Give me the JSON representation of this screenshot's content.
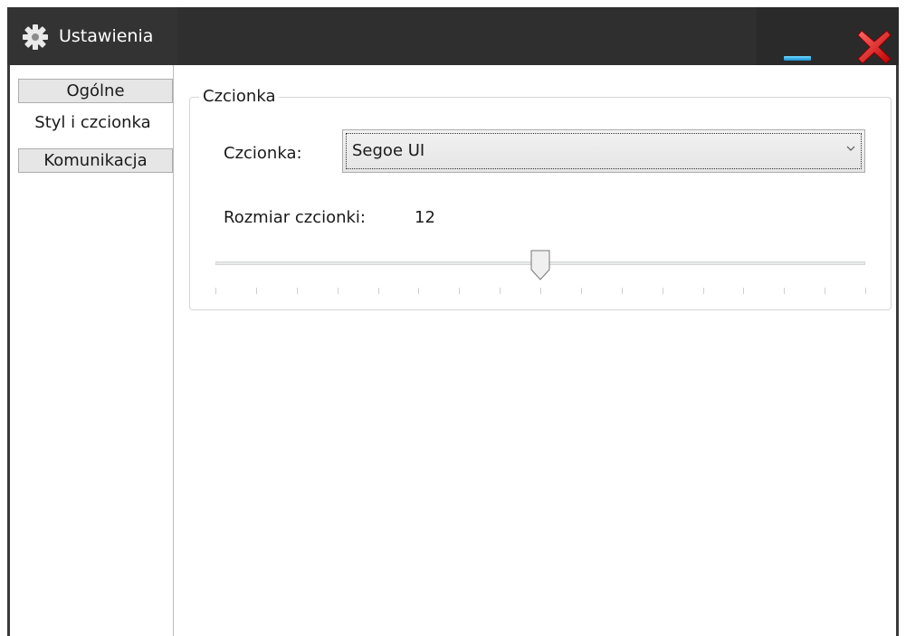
{
  "window": {
    "title": "Ustawienia",
    "icon": "gear-icon",
    "controls": {
      "minimize_icon": "minimize-icon",
      "close_icon": "close-icon"
    }
  },
  "sidebar": {
    "tabs": [
      {
        "label": "Ogólne",
        "active": false
      },
      {
        "label": "Styl i czcionka",
        "active": true
      },
      {
        "label": "Komunikacja",
        "active": false
      }
    ]
  },
  "font_group": {
    "legend": "Czcionka",
    "font_label": "Czcionka:",
    "font_value": "Segoe UI",
    "size_label": "Rozmiar czcionki:",
    "size_value": "12",
    "slider_fraction": 0.5,
    "tick_count": 17
  },
  "colors": {
    "titlebar": "#2f2f2f",
    "minimize_accent": "#1b8fd0",
    "close_accent": "#e02020"
  }
}
